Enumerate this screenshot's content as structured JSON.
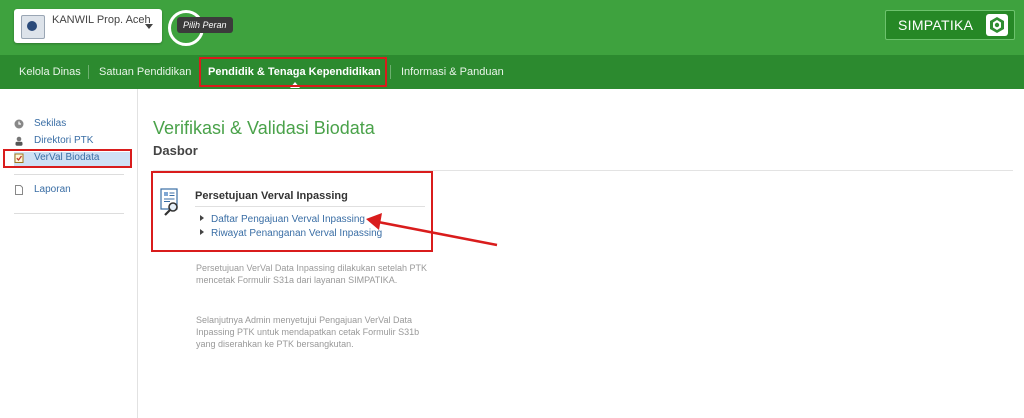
{
  "header": {
    "org_name": "KANWIL Prop. Aceh",
    "role_tooltip": "Pilih Peran",
    "brand": "SIMPATIKA"
  },
  "nav": {
    "items": [
      {
        "label": "Kelola Dinas"
      },
      {
        "label": "Satuan Pendidikan"
      },
      {
        "label": "Pendidik & Tenaga Kependidikan",
        "active": true
      },
      {
        "label": "Informasi & Panduan"
      }
    ]
  },
  "sidebar": {
    "items": [
      {
        "label": "Sekilas",
        "icon": "clock-icon"
      },
      {
        "label": "Direktori PTK",
        "icon": "person-icon"
      },
      {
        "label": "VerVal Biodata",
        "icon": "checklist-icon",
        "active": true
      },
      {
        "label": "Laporan",
        "icon": "document-icon"
      }
    ]
  },
  "main": {
    "title": "Verifikasi & Validasi Biodata",
    "subtitle": "Dasbor",
    "panel": {
      "title": "Persetujuan Verval Inpassing",
      "links": [
        {
          "label": "Daftar Pengajuan Verval Inpassing"
        },
        {
          "label": "Riwayat Penanganan Verval Inpassing"
        }
      ],
      "desc1": "Persetujuan VerVal Data Inpassing dilakukan setelah PTK mencetak Formulir S31a dari layanan SIMPATIKA.",
      "desc2": "Selanjutnya Admin menyetujui Pengajuan VerVal Data Inpassing PTK untuk mendapatkan cetak Formulir S31b yang diserahkan ke PTK bersangkutan."
    }
  },
  "colors": {
    "header_green": "#3ea23e",
    "nav_green": "#2c8a2f",
    "title_green": "#4aa24a",
    "link_blue": "#3a6ea5",
    "highlight_red": "#d91c1c"
  }
}
